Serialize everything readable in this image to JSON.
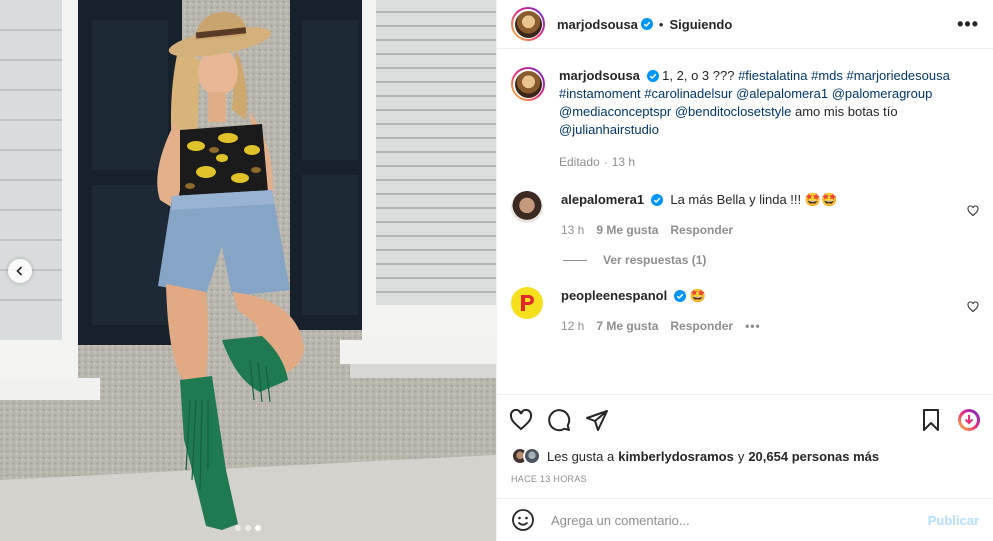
{
  "header": {
    "username": "marjodsousa",
    "separator": "•",
    "following_label": "Siguiendo",
    "more_label": "•••"
  },
  "caption": {
    "username": "marjodsousa",
    "text_plain": "1, 2, o 3 ???",
    "hashtags": [
      "#fiestalatina",
      "#mds",
      "#marjoriedesousa",
      "#instamoment",
      "#carolinadelsur"
    ],
    "mentions_line": [
      "@alepalomera1",
      "@palomeragroup",
      "@mediaconceptspr",
      "@benditoclosetstyle"
    ],
    "text_tail": "amo mis botas tío",
    "last_mention": "@julianhairstudio",
    "edited": "Editado",
    "separator": "·",
    "time": "13 h"
  },
  "comments": [
    {
      "username": "alepalomera1",
      "text": "La más Bella y linda !!!",
      "emoji": "🤩🤩",
      "time": "13 h",
      "likes": "9 Me gusta",
      "reply_label": "Responder",
      "view_replies": "Ver respuestas (1)"
    },
    {
      "username": "peopleenespanol",
      "text": "",
      "emoji": "🤩",
      "time": "12 h",
      "likes": "7 Me gusta",
      "reply_label": "Responder",
      "more_label": "•••"
    }
  ],
  "likes": {
    "prefix": "Les gusta a",
    "user": "kimberlydosramos",
    "connector": "y",
    "count_text": "20,654 personas más"
  },
  "posted_ago": "HACE 13 HORAS",
  "comment_box": {
    "placeholder": "Agrega un comentario...",
    "publish_label": "Publicar"
  },
  "carousel": {
    "total": 3,
    "active_index": 2
  },
  "colors": {
    "link": "#00376b",
    "verified": "#0095f6",
    "muted": "#8e8e8e",
    "publish_disabled": "#b2dffc"
  }
}
